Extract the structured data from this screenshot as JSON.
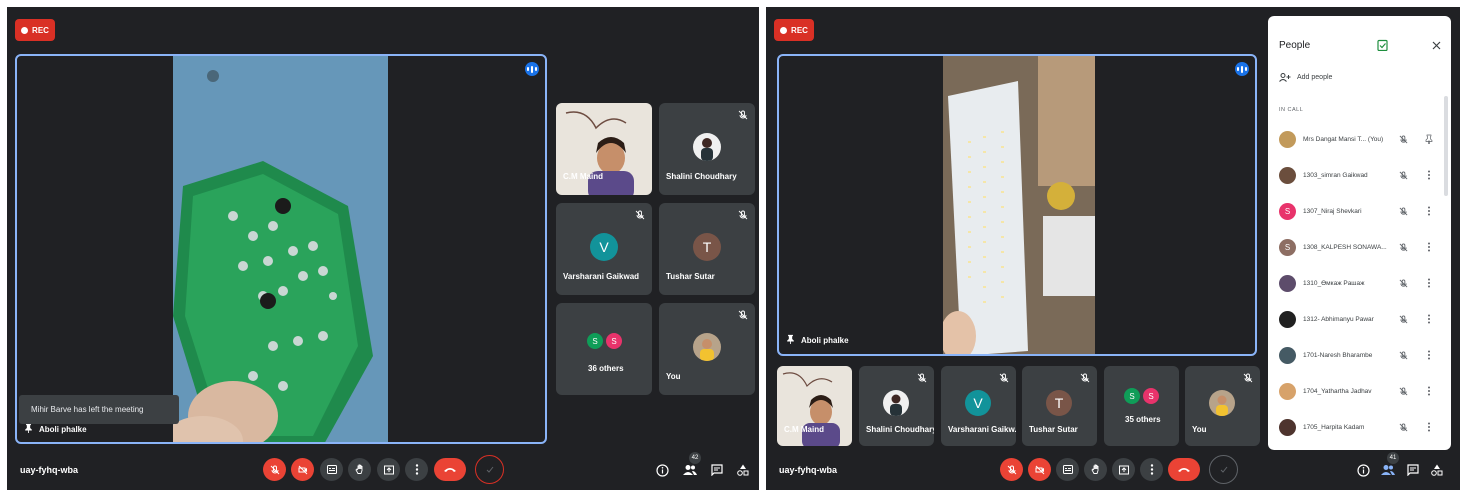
{
  "left": {
    "rec_label": "REC",
    "main_speaker": "Aboli phalke",
    "toast": "Mihir Barve has left the meeting",
    "tiles": [
      {
        "name": "C.M Maind",
        "kind": "photo"
      },
      {
        "name": "Shalini Choudhary",
        "kind": "photo"
      },
      {
        "name": "Varsharani Gaikwad",
        "kind": "letter",
        "letter": "V",
        "color": "#12939a"
      },
      {
        "name": "Tushar Sutar",
        "kind": "letter",
        "letter": "T",
        "color": "#795548"
      },
      {
        "name": "36 others",
        "kind": "group",
        "letters": [
          "S",
          "S"
        ]
      },
      {
        "name": "You",
        "kind": "photo"
      }
    ],
    "meeting_code": "uay-fyhq-wba",
    "people_count": "42"
  },
  "right": {
    "rec_label": "REC",
    "main_speaker": "Aboli phalke",
    "tiles": [
      {
        "name": "C.M Maind"
      },
      {
        "name": "Shalini Choudhary"
      },
      {
        "name": "Varsharani Gaikw...",
        "letter": "V"
      },
      {
        "name": "Tushar Sutar",
        "letter": "T"
      },
      {
        "name": "35 others",
        "letters": [
          "S",
          "S"
        ]
      },
      {
        "name": "You"
      }
    ],
    "meeting_code": "uay-fyhq-wba",
    "people_count": "41",
    "people_panel": {
      "title": "People",
      "add_people": "Add people",
      "section": "IN CALL",
      "participants": [
        {
          "name": "Mrs Dangat Mansi T... (You)",
          "avatar": "photo",
          "action": "pin-icon"
        },
        {
          "name": "1303_simran Gaikwad",
          "avatar": "photo",
          "action": "more-icon"
        },
        {
          "name": "1307_Niraj Shevkari",
          "avatar": "letter",
          "letter": "S",
          "color": "#e8336b",
          "action": "more-icon"
        },
        {
          "name": "1308_KALPESH SONAWA...",
          "avatar": "letter",
          "letter": "S",
          "color": "#8d6e63",
          "action": "more-icon"
        },
        {
          "name": "1310_Өмкаж Paшaж",
          "avatar": "photo",
          "action": "more-icon"
        },
        {
          "name": "1312- Abhimanyu Pawar",
          "avatar": "photo",
          "action": "more-icon"
        },
        {
          "name": "1701-Naresh Bharambe",
          "avatar": "photo",
          "action": "more-icon"
        },
        {
          "name": "1704_Yathartha Jadhav",
          "avatar": "photo",
          "action": "more-icon"
        },
        {
          "name": "1705_Harpita Kadam",
          "avatar": "photo",
          "action": "more-icon"
        }
      ]
    }
  }
}
